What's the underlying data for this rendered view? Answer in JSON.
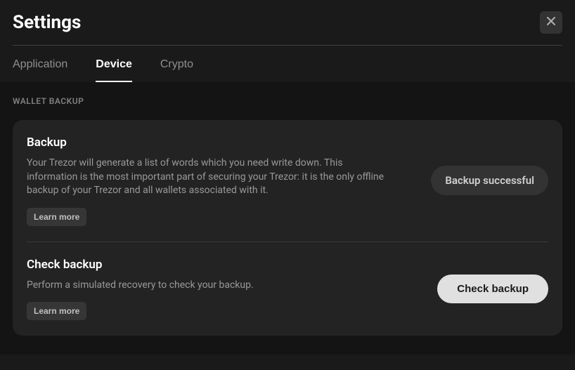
{
  "header": {
    "title": "Settings"
  },
  "tabs": {
    "application": "Application",
    "device": "Device",
    "crypto": "Crypto"
  },
  "section": {
    "wallet_backup_label": "WALLET BACKUP"
  },
  "backup": {
    "title": "Backup",
    "description": "Your Trezor will generate a list of words which you need write down. This information is the most important part of securing your Trezor: it is the only offline backup of your Trezor and all wallets associated with it.",
    "learn_more": "Learn more",
    "status": "Backup successful"
  },
  "check_backup": {
    "title": "Check backup",
    "description": "Perform a simulated recovery to check your backup.",
    "learn_more": "Learn more",
    "button": "Check backup"
  }
}
